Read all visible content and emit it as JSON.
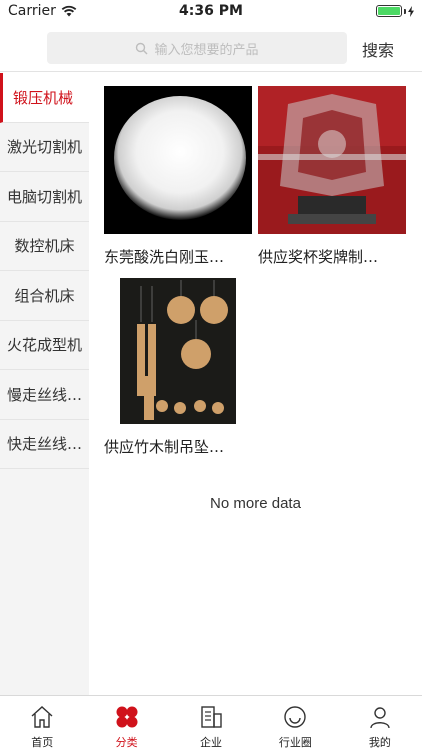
{
  "status_bar": {
    "carrier": "Carrier",
    "time": "4:36 PM"
  },
  "search": {
    "placeholder": "输入您想要的产品",
    "button_label": "搜索"
  },
  "sidebar": {
    "items": [
      {
        "label": "锻压机械",
        "active": true
      },
      {
        "label": "激光切割机",
        "active": false
      },
      {
        "label": "电脑切割机",
        "active": false
      },
      {
        "label": "数控机床",
        "active": false
      },
      {
        "label": "组合机床",
        "active": false
      },
      {
        "label": "火花成型机",
        "active": false
      },
      {
        "label": "慢走丝线…",
        "active": false
      },
      {
        "label": "快走丝线…",
        "active": false
      }
    ]
  },
  "products": [
    {
      "title": "东莞酸洗白刚玉…",
      "image": "white-powder-photo"
    },
    {
      "title": "供应奖杯奖牌制…",
      "image": "crystal-trophy-photo"
    },
    {
      "title": "供应竹木制吊坠…",
      "image": "bamboo-pendants-photo"
    }
  ],
  "footer": {
    "no_more": "No more data"
  },
  "tabbar": {
    "tabs": [
      {
        "label": "首页",
        "icon": "home-icon",
        "active": false
      },
      {
        "label": "分类",
        "icon": "category-icon",
        "active": true
      },
      {
        "label": "企业",
        "icon": "building-icon",
        "active": false
      },
      {
        "label": "行业圈",
        "icon": "smile-icon",
        "active": false
      },
      {
        "label": "我的",
        "icon": "person-icon",
        "active": false
      }
    ]
  },
  "colors": {
    "accent": "#d0121b",
    "battery": "#4cd964",
    "sidebar_bg": "#f4f4f4"
  }
}
